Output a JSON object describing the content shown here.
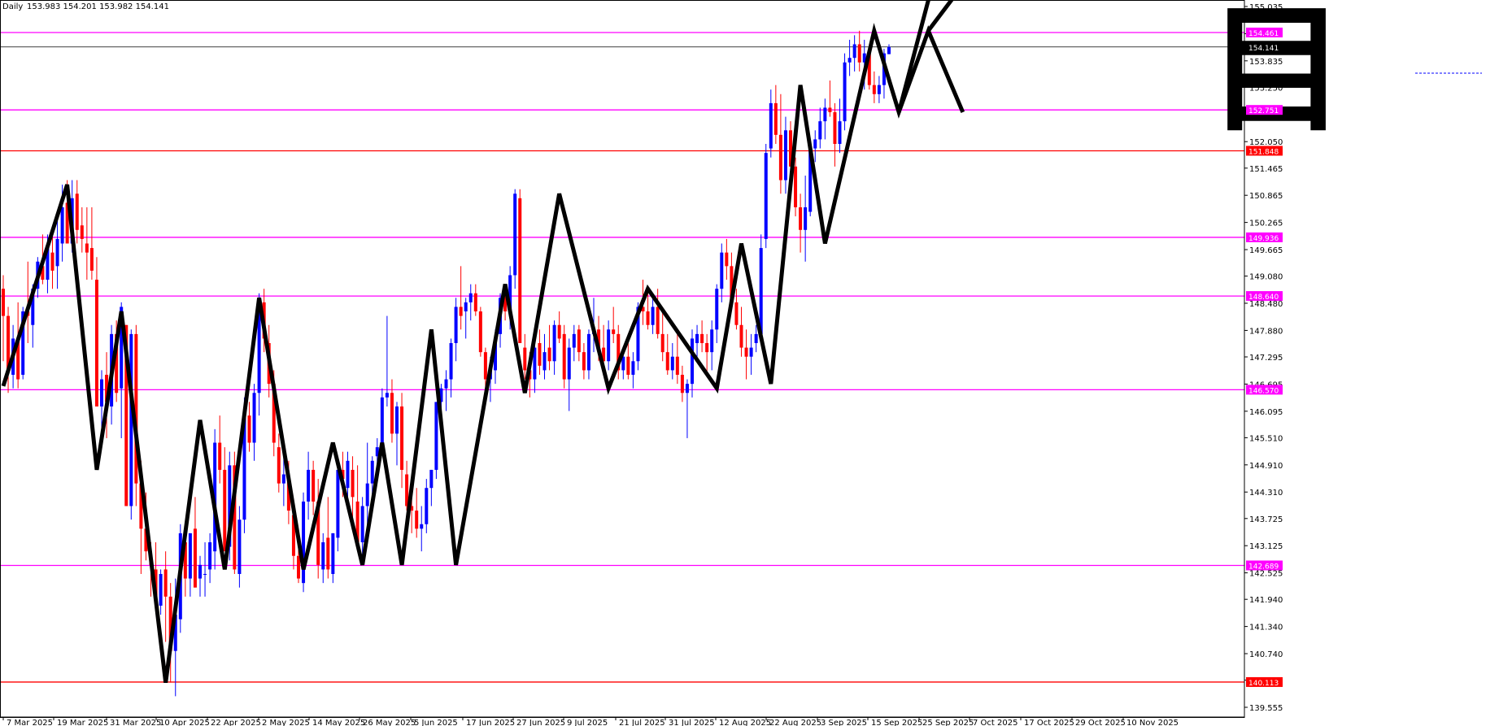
{
  "header": {
    "symbol": "",
    "timeframe": "Daily",
    "ohlc": "153.983 154.201 153.982 154.141"
  },
  "chart_data": {
    "type": "candlestick",
    "title": "",
    "ylim": [
      139.555,
      155.035
    ],
    "y_ticks": [
      155.035,
      154.435,
      153.835,
      153.25,
      152.65,
      152.05,
      151.465,
      150.865,
      150.265,
      149.665,
      149.08,
      148.48,
      147.88,
      147.295,
      146.695,
      146.095,
      145.51,
      144.91,
      144.31,
      143.725,
      143.125,
      142.525,
      141.94,
      141.34,
      140.74,
      140.155,
      139.555
    ],
    "y_tick_labels": [
      "155.035",
      "154.435",
      "153.835",
      "153.250",
      "152.650",
      "152.050",
      "151.465",
      "150.865",
      "150.265",
      "149.665",
      "149.080",
      "148.480",
      "147.880",
      "147.295",
      "146.695",
      "146.095",
      "145.510",
      "144.910",
      "144.310",
      "143.725",
      "143.125",
      "142.525",
      "141.940",
      "141.340",
      "140.740",
      "140.155",
      "139.555"
    ],
    "x_tick_labels": [
      "7 Mar 2025",
      "19 Mar 2025",
      "31 Mar 2025",
      "10 Apr 2025",
      "22 Apr 2025",
      "2 May 2025",
      "14 May 2025",
      "26 May 2025",
      "5 Jun 2025",
      "17 Jun 2025",
      "27 Jun 2025",
      "9 Jul 2025",
      "21 Jul 2025",
      "31 Jul 2025",
      "12 Aug 2025",
      "22 Aug 2025",
      "3 Sep 2025",
      "15 Sep 2025",
      "25 Sep 2025",
      "7 Oct 2025",
      "17 Oct 2025",
      "29 Oct 2025",
      "10 Nov 2025"
    ],
    "horizontal_levels": [
      {
        "value": 154.461,
        "label": "154.461",
        "color": "#ff00ff"
      },
      {
        "value": 152.751,
        "label": "152.751",
        "color": "#ff00ff"
      },
      {
        "value": 151.848,
        "label": "151.848",
        "color": "#ff0000"
      },
      {
        "value": 149.936,
        "label": "149.936",
        "color": "#ff00ff"
      },
      {
        "value": 148.64,
        "label": "148.640",
        "color": "#ff00ff"
      },
      {
        "value": 146.57,
        "label": "146.570",
        "color": "#ff00ff"
      },
      {
        "value": 142.689,
        "label": "142.689",
        "color": "#ff00ff"
      },
      {
        "value": 140.113,
        "label": "140.113",
        "color": "#ff0000"
      }
    ],
    "current_price": {
      "value": 154.141,
      "label": "154.141",
      "color": "#000000"
    },
    "candles": [
      [
        148.8,
        149.1,
        147.2,
        148.2
      ],
      [
        148.2,
        148.4,
        146.5,
        147.0
      ],
      [
        146.9,
        148.0,
        146.6,
        147.7
      ],
      [
        147.7,
        148.5,
        146.6,
        146.8
      ],
      [
        146.9,
        148.4,
        146.8,
        148.3
      ],
      [
        148.3,
        149.4,
        147.6,
        148.2
      ],
      [
        148.0,
        148.9,
        147.5,
        148.8
      ],
      [
        148.8,
        149.5,
        148.6,
        149.4
      ],
      [
        149.3,
        150.0,
        148.9,
        149.0
      ],
      [
        149.0,
        150.0,
        148.7,
        149.7
      ],
      [
        149.6,
        150.2,
        148.8,
        149.2
      ],
      [
        149.3,
        150.3,
        148.8,
        149.9
      ],
      [
        149.8,
        151.1,
        149.4,
        150.6
      ],
      [
        150.7,
        151.2,
        149.8,
        149.8
      ],
      [
        149.8,
        151.2,
        149.6,
        150.8
      ],
      [
        150.9,
        151.2,
        149.8,
        150.1
      ],
      [
        150.2,
        150.6,
        149.6,
        149.9
      ],
      [
        149.8,
        150.6,
        149.0,
        149.6
      ],
      [
        149.7,
        150.6,
        149.0,
        149.2
      ],
      [
        149.0,
        149.5,
        147.2,
        146.2
      ],
      [
        146.2,
        147.0,
        145.5,
        146.8
      ],
      [
        146.9,
        147.4,
        145.5,
        146.3
      ],
      [
        146.2,
        148.0,
        145.8,
        147.8
      ],
      [
        147.8,
        148.1,
        146.3,
        146.5
      ],
      [
        146.6,
        148.5,
        145.5,
        148.4
      ],
      [
        148.0,
        148.0,
        145.0,
        144.0
      ],
      [
        144.0,
        147.9,
        143.7,
        147.8
      ],
      [
        147.8,
        148.0,
        144.0,
        144.5
      ],
      [
        144.5,
        145.0,
        142.5,
        143.5
      ],
      [
        143.5,
        144.3,
        142.8,
        143.0
      ],
      [
        142.9,
        143.2,
        142.0,
        142.7
      ],
      [
        142.6,
        143.2,
        141.8,
        141.9
      ],
      [
        141.8,
        142.6,
        141.6,
        142.5
      ],
      [
        142.6,
        143.0,
        141.0,
        142.0
      ],
      [
        142.0,
        142.3,
        140.1,
        140.8
      ],
      [
        140.8,
        142.4,
        139.8,
        141.6
      ],
      [
        141.5,
        143.6,
        141.2,
        143.4
      ],
      [
        143.2,
        143.6,
        142.0,
        142.4
      ],
      [
        142.4,
        143.4,
        142.0,
        143.4
      ],
      [
        143.5,
        144.2,
        142.6,
        142.2
      ],
      [
        142.4,
        142.9,
        142.0,
        142.7
      ],
      [
        142.5,
        143.2,
        142.0,
        142.5
      ],
      [
        142.6,
        143.4,
        142.3,
        143.2
      ],
      [
        143.0,
        145.7,
        142.6,
        145.4
      ],
      [
        145.4,
        146.0,
        144.5,
        144.8
      ],
      [
        144.8,
        145.3,
        143.2,
        143.0
      ],
      [
        143.1,
        145.2,
        142.8,
        144.9
      ],
      [
        144.9,
        145.2,
        142.5,
        142.6
      ],
      [
        142.5,
        144.0,
        142.2,
        143.7
      ],
      [
        143.7,
        146.4,
        143.4,
        146.0
      ],
      [
        146.0,
        146.3,
        145.2,
        145.4
      ],
      [
        145.4,
        146.7,
        145.0,
        146.5
      ],
      [
        146.5,
        148.7,
        146.0,
        148.5
      ],
      [
        148.5,
        148.8,
        147.4,
        147.7
      ],
      [
        147.6,
        148.0,
        146.4,
        146.7
      ],
      [
        146.7,
        147.0,
        145.1,
        145.4
      ],
      [
        145.3,
        145.6,
        144.3,
        144.5
      ],
      [
        144.5,
        145.2,
        144.0,
        144.7
      ],
      [
        144.6,
        145.0,
        143.6,
        143.9
      ],
      [
        143.8,
        144.1,
        142.6,
        142.9
      ],
      [
        142.9,
        143.5,
        142.3,
        142.4
      ],
      [
        142.3,
        144.3,
        142.1,
        144.1
      ],
      [
        144.1,
        145.2,
        143.7,
        144.8
      ],
      [
        144.8,
        145.0,
        143.8,
        144.1
      ],
      [
        144.1,
        144.6,
        142.4,
        142.7
      ],
      [
        142.6,
        143.4,
        142.3,
        143.2
      ],
      [
        143.3,
        144.2,
        142.4,
        142.6
      ],
      [
        142.5,
        143.4,
        142.3,
        143.4
      ],
      [
        143.3,
        145.0,
        143.0,
        144.8
      ],
      [
        144.8,
        145.2,
        144.2,
        144.6
      ],
      [
        144.4,
        145.2,
        144.2,
        145.0
      ],
      [
        144.8,
        145.1,
        143.6,
        144.2
      ],
      [
        144.1,
        144.9,
        143.0,
        143.2
      ],
      [
        143.2,
        144.2,
        142.9,
        144.0
      ],
      [
        144.0,
        145.4,
        143.6,
        144.5
      ],
      [
        144.5,
        145.1,
        144.0,
        145.0
      ],
      [
        145.1,
        145.5,
        144.8,
        145.3
      ],
      [
        145.3,
        146.6,
        145.2,
        146.4
      ],
      [
        146.4,
        148.2,
        146.2,
        146.5
      ],
      [
        146.5,
        146.8,
        145.4,
        145.6
      ],
      [
        145.6,
        146.3,
        144.9,
        146.2
      ],
      [
        146.2,
        146.5,
        144.4,
        144.8
      ],
      [
        144.7,
        145.0,
        143.9,
        144.0
      ],
      [
        144.0,
        144.4,
        143.4,
        143.9
      ],
      [
        143.9,
        144.4,
        143.3,
        143.5
      ],
      [
        143.5,
        144.0,
        143.0,
        143.6
      ],
      [
        143.6,
        144.6,
        143.4,
        144.4
      ],
      [
        144.4,
        144.8,
        144.0,
        144.8
      ],
      [
        144.8,
        146.3,
        144.6,
        146.3
      ],
      [
        146.3,
        146.7,
        145.9,
        146.6
      ],
      [
        146.6,
        147.0,
        146.1,
        146.8
      ],
      [
        146.8,
        147.7,
        146.4,
        147.6
      ],
      [
        147.6,
        148.6,
        147.2,
        148.4
      ],
      [
        148.4,
        149.3,
        147.9,
        148.2
      ],
      [
        148.3,
        148.6,
        147.7,
        148.5
      ],
      [
        148.5,
        148.9,
        148.1,
        148.7
      ],
      [
        148.7,
        148.9,
        148.2,
        148.3
      ],
      [
        148.3,
        148.4,
        147.3,
        147.4
      ],
      [
        147.4,
        147.5,
        146.6,
        146.8
      ],
      [
        146.8,
        147.3,
        146.3,
        147.0
      ],
      [
        147.0,
        147.9,
        146.7,
        147.7
      ],
      [
        147.8,
        148.7,
        147.5,
        148.6
      ],
      [
        148.6,
        148.9,
        148.1,
        148.3
      ],
      [
        148.3,
        149.3,
        147.9,
        149.1
      ],
      [
        149.1,
        151.0,
        148.8,
        150.9
      ],
      [
        150.8,
        151.0,
        147.7,
        147.6
      ],
      [
        147.5,
        147.8,
        146.8,
        147.0
      ],
      [
        147.0,
        147.4,
        146.4,
        146.8
      ],
      [
        146.8,
        147.8,
        146.5,
        147.5
      ],
      [
        147.6,
        147.9,
        146.9,
        147.1
      ],
      [
        147.0,
        147.8,
        146.8,
        147.4
      ],
      [
        147.5,
        148.0,
        147.0,
        147.2
      ],
      [
        147.2,
        148.1,
        146.9,
        148.0
      ],
      [
        148.0,
        148.3,
        147.6,
        147.7
      ],
      [
        147.8,
        148.0,
        146.6,
        146.8
      ],
      [
        146.8,
        147.7,
        146.1,
        147.5
      ],
      [
        147.5,
        148.0,
        147.2,
        147.8
      ],
      [
        147.9,
        148.0,
        147.2,
        147.4
      ],
      [
        147.4,
        147.6,
        146.8,
        147.0
      ],
      [
        147.0,
        147.9,
        146.8,
        147.8
      ],
      [
        147.8,
        148.6,
        147.4,
        147.9
      ],
      [
        147.9,
        148.2,
        147.2,
        147.5
      ],
      [
        147.5,
        148.0,
        146.9,
        147.2
      ],
      [
        147.2,
        148.1,
        147.0,
        147.9
      ],
      [
        147.9,
        148.4,
        147.6,
        147.8
      ],
      [
        147.8,
        148.0,
        146.8,
        147.0
      ],
      [
        147.0,
        147.4,
        146.8,
        147.3
      ],
      [
        147.3,
        147.8,
        146.8,
        146.9
      ],
      [
        146.9,
        147.4,
        146.6,
        147.2
      ],
      [
        147.2,
        148.5,
        147.0,
        148.4
      ],
      [
        148.4,
        149.0,
        148.0,
        148.3
      ],
      [
        148.3,
        148.7,
        147.9,
        148.0
      ],
      [
        148.0,
        148.6,
        147.8,
        148.4
      ],
      [
        148.4,
        148.8,
        147.7,
        147.8
      ],
      [
        147.8,
        148.3,
        147.2,
        147.4
      ],
      [
        147.4,
        147.8,
        146.9,
        147.0
      ],
      [
        147.0,
        147.6,
        146.8,
        147.3
      ],
      [
        147.3,
        147.9,
        146.7,
        146.9
      ],
      [
        146.9,
        147.1,
        146.3,
        146.5
      ],
      [
        146.5,
        146.8,
        145.5,
        146.7
      ],
      [
        146.7,
        147.9,
        146.4,
        147.7
      ],
      [
        147.6,
        148.0,
        147.3,
        147.8
      ],
      [
        147.8,
        148.1,
        147.4,
        147.6
      ],
      [
        147.6,
        147.8,
        146.9,
        147.4
      ],
      [
        147.4,
        148.1,
        147.0,
        147.9
      ],
      [
        147.9,
        148.9,
        147.6,
        148.8
      ],
      [
        148.8,
        149.8,
        148.5,
        149.6
      ],
      [
        149.6,
        149.9,
        149.0,
        149.3
      ],
      [
        149.3,
        149.6,
        148.4,
        148.5
      ],
      [
        148.5,
        148.8,
        147.9,
        148.0
      ],
      [
        148.0,
        148.4,
        147.3,
        147.5
      ],
      [
        147.5,
        147.9,
        146.8,
        147.3
      ],
      [
        147.3,
        147.8,
        146.9,
        147.5
      ],
      [
        147.6,
        148.0,
        147.4,
        147.8
      ],
      [
        147.8,
        150.0,
        147.7,
        149.7
      ],
      [
        149.9,
        152.0,
        149.7,
        151.8
      ],
      [
        151.9,
        153.2,
        151.7,
        152.9
      ],
      [
        152.9,
        153.3,
        152.0,
        152.2
      ],
      [
        152.2,
        153.1,
        150.9,
        151.2
      ],
      [
        151.2,
        152.6,
        150.9,
        152.3
      ],
      [
        152.3,
        152.5,
        151.3,
        151.5
      ],
      [
        151.5,
        151.7,
        150.4,
        150.6
      ],
      [
        150.6,
        150.9,
        149.6,
        150.1
      ],
      [
        150.1,
        151.3,
        149.4,
        150.6
      ],
      [
        150.5,
        152.0,
        150.4,
        151.9
      ],
      [
        151.9,
        152.3,
        151.6,
        152.1
      ],
      [
        152.1,
        152.8,
        151.9,
        152.5
      ],
      [
        152.5,
        153.0,
        152.1,
        152.8
      ],
      [
        152.8,
        153.4,
        152.6,
        152.7
      ],
      [
        152.7,
        152.9,
        151.5,
        152.0
      ],
      [
        152.0,
        153.0,
        151.8,
        152.5
      ],
      [
        152.5,
        154.0,
        152.3,
        153.8
      ],
      [
        153.8,
        154.3,
        153.5,
        153.9
      ],
      [
        153.9,
        154.4,
        153.6,
        154.2
      ],
      [
        154.2,
        154.5,
        153.6,
        153.8
      ],
      [
        153.8,
        154.3,
        153.2,
        154.0
      ],
      [
        154.0,
        154.1,
        153.2,
        153.3
      ],
      [
        153.3,
        153.6,
        152.9,
        153.1
      ],
      [
        153.1,
        153.5,
        152.9,
        153.3
      ],
      [
        153.3,
        154.1,
        153.0,
        154.0
      ],
      [
        153.983,
        154.201,
        153.982,
        154.141
      ]
    ],
    "zigzag": [
      [
        0,
        146.65
      ],
      [
        13,
        151.1
      ],
      [
        19,
        144.8
      ],
      [
        24,
        148.3
      ],
      [
        33,
        140.1
      ],
      [
        40,
        145.9
      ],
      [
        45,
        142.6
      ],
      [
        52,
        148.6
      ],
      [
        61,
        142.6
      ],
      [
        67,
        145.4
      ],
      [
        73,
        142.7
      ],
      [
        77,
        145.4
      ],
      [
        81,
        142.7
      ],
      [
        87,
        147.9
      ],
      [
        92,
        142.7
      ],
      [
        102,
        148.9
      ],
      [
        106,
        146.5
      ],
      [
        113,
        150.9
      ],
      [
        123,
        146.6
      ],
      [
        131,
        148.8
      ],
      [
        145,
        146.6
      ],
      [
        150,
        149.8
      ],
      [
        156,
        146.7
      ],
      [
        162,
        153.3
      ],
      [
        167,
        149.8
      ],
      [
        177,
        154.5
      ],
      [
        182,
        152.7
      ],
      [
        188,
        154.5
      ],
      [
        195,
        152.7
      ]
    ],
    "zigzag_tail": [
      [
        182,
        152.7
      ],
      [
        190,
        156.0
      ]
    ],
    "candle_colors": {
      "up": "#0000ff",
      "down": "#ff0000"
    },
    "level_label_text_color": "#ffffff",
    "zigzag_color": "#000000",
    "watermark_glyph": "目",
    "grid": false,
    "legend": "none"
  }
}
